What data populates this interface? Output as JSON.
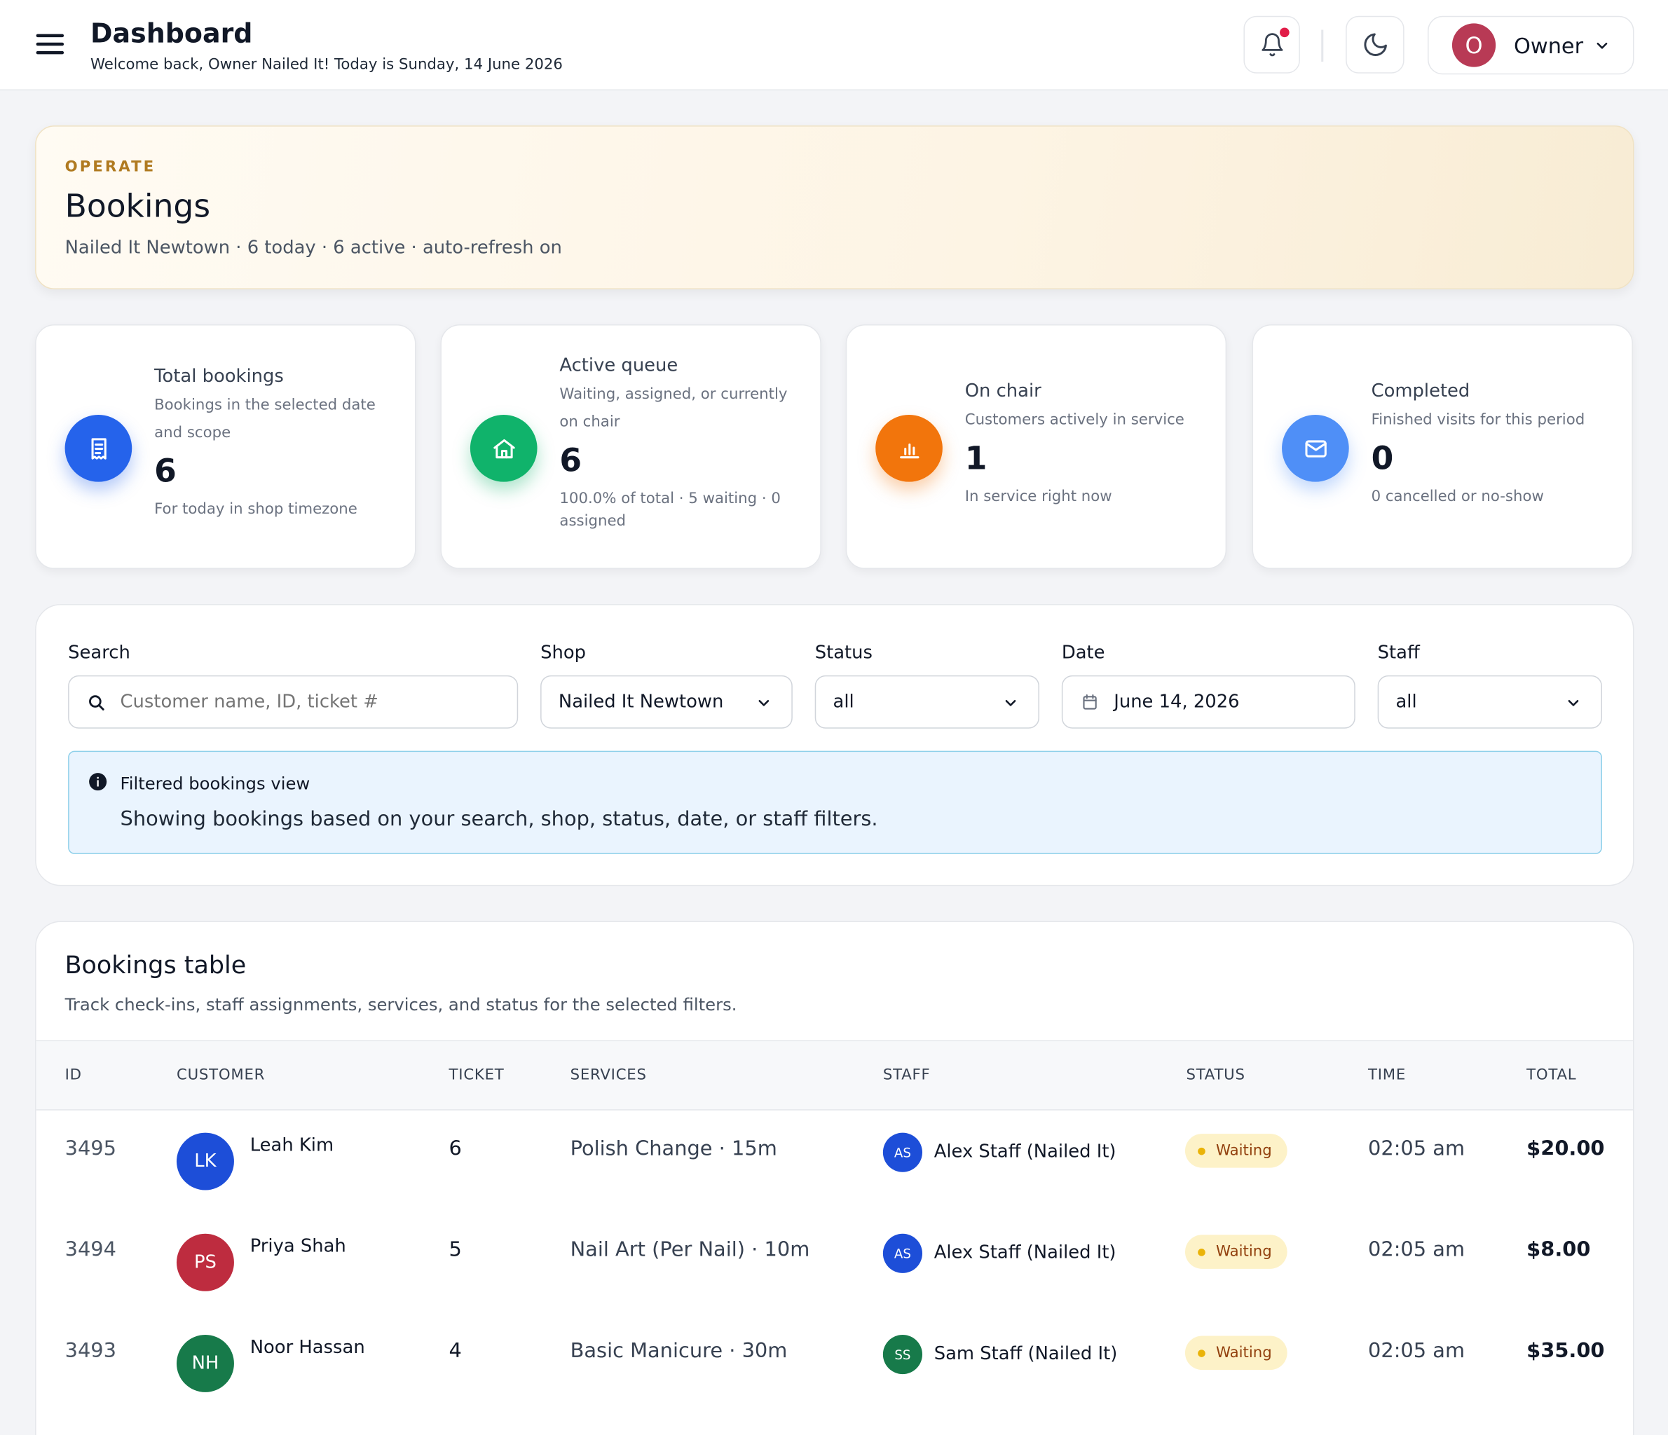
{
  "header": {
    "title": "Dashboard",
    "subtitle": "Welcome back, Owner Nailed It! Today is Sunday, 14 June 2026",
    "user_initial": "O",
    "user_name": "Owner"
  },
  "hero": {
    "eyebrow": "OPERATE",
    "title": "Bookings",
    "subtitle": "Nailed It Newtown · 6 today · 6 active · auto-refresh on"
  },
  "stats": [
    {
      "label": "Total bookings",
      "desc": "Bookings in the selected date and scope",
      "value": "6",
      "foot": "For today in shop timezone",
      "icon": "receipt-icon",
      "color": "#2563eb"
    },
    {
      "label": "Active queue",
      "desc": "Waiting, assigned, or currently on chair",
      "value": "6",
      "foot": "100.0% of total · 5 waiting · 0 assigned",
      "icon": "home-icon",
      "color": "#10b36b"
    },
    {
      "label": "On chair",
      "desc": "Customers actively in service",
      "value": "1",
      "foot": "In service right now",
      "icon": "bar-chart-icon",
      "color": "#f2750c"
    },
    {
      "label": "Completed",
      "desc": "Finished visits for this period",
      "value": "0",
      "foot": "0 cancelled or no-show",
      "icon": "mail-icon",
      "color": "#4f8ff7"
    }
  ],
  "filters": {
    "search_label": "Search",
    "search_placeholder": "Customer name, ID, ticket #",
    "shop_label": "Shop",
    "shop_value": "Nailed It Newtown",
    "status_label": "Status",
    "status_value": "all",
    "date_label": "Date",
    "date_value": "June 14, 2026",
    "staff_label": "Staff",
    "staff_value": "all"
  },
  "info": {
    "title": "Filtered bookings view",
    "text": "Showing bookings based on your search, shop, status, date, or staff filters."
  },
  "table": {
    "title": "Bookings table",
    "subtitle": "Track check-ins, staff assignments, services, and status for the selected filters.",
    "columns": [
      "ID",
      "CUSTOMER",
      "TICKET",
      "SERVICES",
      "STAFF",
      "STATUS",
      "TIME",
      "TOTAL"
    ],
    "rows": [
      {
        "id": "3495",
        "initials": "LK",
        "avatar_color": "#1d4ed8",
        "customer": "Leah Kim",
        "ticket": "6",
        "service": "Polish Change · 15m",
        "staff_initials": "AS",
        "staff_color": "#1d4ed8",
        "staff": "Alex Staff (Nailed It)",
        "status": "Waiting",
        "time": "02:05 am",
        "total": "$20.00"
      },
      {
        "id": "3494",
        "initials": "PS",
        "avatar_color": "#be2c3f",
        "customer": "Priya Shah",
        "ticket": "5",
        "service": "Nail Art (Per Nail) · 10m",
        "staff_initials": "AS",
        "staff_color": "#1d4ed8",
        "staff": "Alex Staff (Nailed It)",
        "status": "Waiting",
        "time": "02:05 am",
        "total": "$8.00"
      },
      {
        "id": "3493",
        "initials": "NH",
        "avatar_color": "#177a4a",
        "customer": "Noor Hassan",
        "ticket": "4",
        "service": "Basic Manicure · 30m",
        "staff_initials": "SS",
        "staff_color": "#177a4a",
        "staff": "Sam Staff (Nailed It)",
        "status": "Waiting",
        "time": "02:05 am",
        "total": "$35.00"
      }
    ]
  }
}
